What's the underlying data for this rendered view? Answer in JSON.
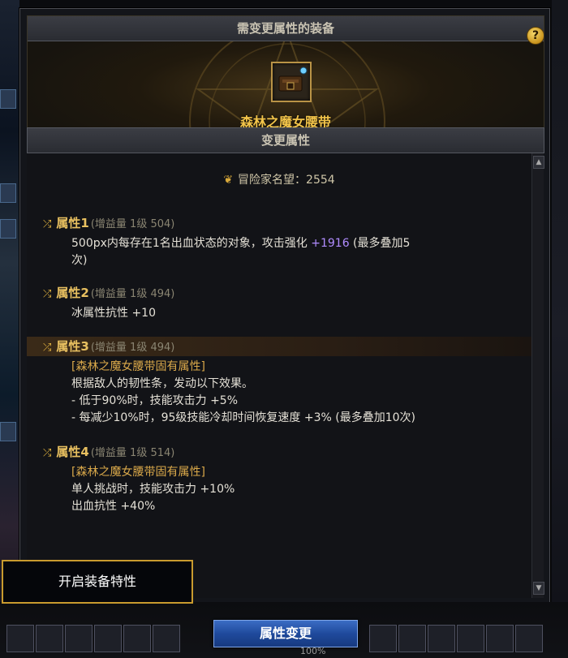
{
  "window": {
    "header_title": "需变更属性的装备",
    "help_label": "?",
    "item_name": "森林之魔女腰带",
    "section_title": "变更属性",
    "fame_label": "冒险家名望：2554"
  },
  "attributes": [
    {
      "name": "属性1",
      "meta": "(增益量 1级 504)",
      "lines": [
        {
          "parts": [
            {
              "text": "500px内每存在1名出血状态的对象，攻击强化 ",
              "style": "normal"
            },
            {
              "text": "+1916",
              "style": "purple"
            },
            {
              "text": " (最多叠加5",
              "style": "normal"
            }
          ]
        },
        {
          "parts": [
            {
              "text": "次)",
              "style": "normal"
            }
          ]
        }
      ]
    },
    {
      "name": "属性2",
      "meta": "(增益量 1级 494)",
      "lines": [
        {
          "parts": [
            {
              "text": "冰属性抗性 +10",
              "style": "normal"
            }
          ]
        }
      ]
    },
    {
      "name": "属性3",
      "meta": "(增益量 1级 494)",
      "highlighted": true,
      "lines": [
        {
          "parts": [
            {
              "text": "[森林之魔女腰带固有属性]",
              "style": "gold"
            }
          ]
        },
        {
          "parts": [
            {
              "text": "根据敌人的韧性条，发动以下效果。",
              "style": "normal"
            }
          ]
        },
        {
          "parts": [
            {
              "text": "- 低于90%时，技能攻击力 +5%",
              "style": "normal"
            }
          ]
        },
        {
          "parts": [
            {
              "text": "- 每减少10%时，95级技能冷却时间恢复速度 +3% (最多叠加10次)",
              "style": "normal"
            }
          ]
        }
      ]
    },
    {
      "name": "属性4",
      "meta": "(增益量 1级 514)",
      "lines": [
        {
          "parts": [
            {
              "text": "[森林之魔女腰带固有属性]",
              "style": "gold"
            }
          ]
        },
        {
          "parts": [
            {
              "text": "单人挑战时，技能攻击力 +10%",
              "style": "normal"
            }
          ]
        },
        {
          "parts": [
            {
              "text": "出血抗性 +40%",
              "style": "normal"
            }
          ]
        }
      ]
    }
  ],
  "buttons": {
    "convert_label": "属性变更",
    "feature_label": "开启装备特性"
  },
  "bottom": {
    "percent_label": "100%"
  },
  "icons": {
    "shuffle": "shuffle-icon",
    "crest": "fame-crest-icon",
    "help": "help-icon"
  },
  "colors": {
    "item_name": "#f2c44a",
    "attr_name": "#e8c060",
    "purple_value": "#b08cff",
    "gold_text": "#d9a84a",
    "button_blue": "#1f4a9c"
  }
}
